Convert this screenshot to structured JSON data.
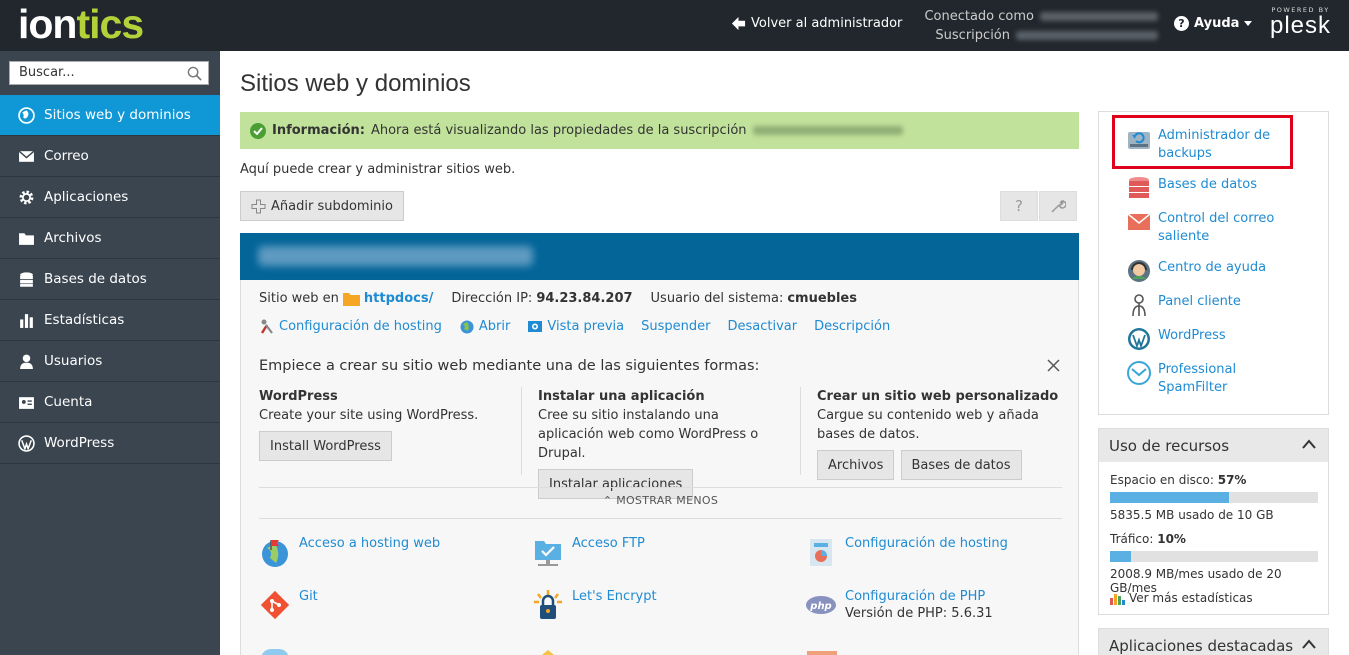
{
  "topbar": {
    "logo_part1": "ion",
    "logo_part2": "tics",
    "back_label": "Volver al administrador",
    "connected_label": "Conectado como",
    "subscription_label": "Suscripción",
    "help_label": "Ayuda",
    "powered_by": "POWERED BY",
    "plesk": "plesk"
  },
  "sidebar": {
    "search_placeholder": "Buscar...",
    "items": [
      {
        "label": "Sitios web y dominios",
        "icon": "globe-icon"
      },
      {
        "label": "Correo",
        "icon": "mail-icon"
      },
      {
        "label": "Aplicaciones",
        "icon": "gear-icon"
      },
      {
        "label": "Archivos",
        "icon": "folder-icon"
      },
      {
        "label": "Bases de datos",
        "icon": "database-icon"
      },
      {
        "label": "Estadísticas",
        "icon": "bar-chart-icon"
      },
      {
        "label": "Usuarios",
        "icon": "user-icon"
      },
      {
        "label": "Cuenta",
        "icon": "account-icon"
      },
      {
        "label": "WordPress",
        "icon": "wordpress-icon"
      }
    ]
  },
  "main": {
    "title": "Sitios web y dominios",
    "info_label": "Información:",
    "info_text": "Ahora está visualizando las propiedades de la suscripción",
    "description": "Aquí puede crear y administrar sitios web.",
    "add_subdomain": "Añadir subdominio",
    "domain": {
      "website_at": "Sitio web en",
      "docroot": "httpdocs/",
      "ip_label": "Dirección IP:",
      "ip": "94.23.84.207",
      "sysuser_label": "Usuario del sistema:",
      "sysuser": "cmuebles",
      "actions": [
        "Configuración de hosting",
        "Abrir",
        "Vista previa",
        "Suspender",
        "Desactivar",
        "Descripción"
      ]
    },
    "start": {
      "title": "Empiece a crear su sitio web mediante una de las siguientes formas:",
      "columns": [
        {
          "heading": "WordPress",
          "text": "Create your site using WordPress.",
          "buttons": [
            "Install WordPress"
          ]
        },
        {
          "heading": "Instalar una aplicación",
          "text": "Cree su sitio instalando una aplicación web como WordPress o Drupal.",
          "buttons": [
            "Instalar aplicaciones"
          ]
        },
        {
          "heading": "Crear un sitio web personalizado",
          "text": "Cargue su contenido web y añada bases de datos.",
          "buttons": [
            "Archivos",
            "Bases de datos"
          ]
        }
      ]
    },
    "show_less": "MOSTRAR MENOS",
    "tools": [
      {
        "label": "Acceso a hosting web",
        "icon": "globe-flag-icon"
      },
      {
        "label": "Acceso FTP",
        "icon": "ftp-folder-icon"
      },
      {
        "label": "Configuración de hosting",
        "icon": "hosting-settings-icon"
      },
      {
        "label": "Git",
        "icon": "git-icon"
      },
      {
        "label": "Let's Encrypt",
        "icon": "lets-encrypt-icon"
      },
      {
        "label": "Configuración de PHP",
        "icon": "php-icon",
        "sub": "Versión de PHP: 5.6.31"
      }
    ]
  },
  "right": {
    "links": [
      "Administrador de backups",
      "Bases de datos",
      "Control del correo saliente",
      "Centro de ayuda",
      "Panel cliente",
      "WordPress",
      "Professional SpamFilter"
    ],
    "resources": {
      "title": "Uso de recursos",
      "disk_label": "Espacio en disco:",
      "disk_pct": "57%",
      "disk_fraction": 0.57,
      "disk_used": "5835.5 MB usado de 10 GB",
      "traffic_label": "Tráfico:",
      "traffic_pct": "10%",
      "traffic_fraction": 0.1,
      "traffic_used": "2008.9 MB/mes usado de 20 GB/mes",
      "more_stats": "Ver más estadísticas"
    },
    "featured_apps": "Aplicaciones destacadas"
  },
  "colors": {
    "accent": "#1097d5",
    "topbar": "#21272d",
    "sidebar": "#3b4550",
    "info": "#c1e29b",
    "domain_header": "#036598",
    "highlight": "#e0001b"
  }
}
